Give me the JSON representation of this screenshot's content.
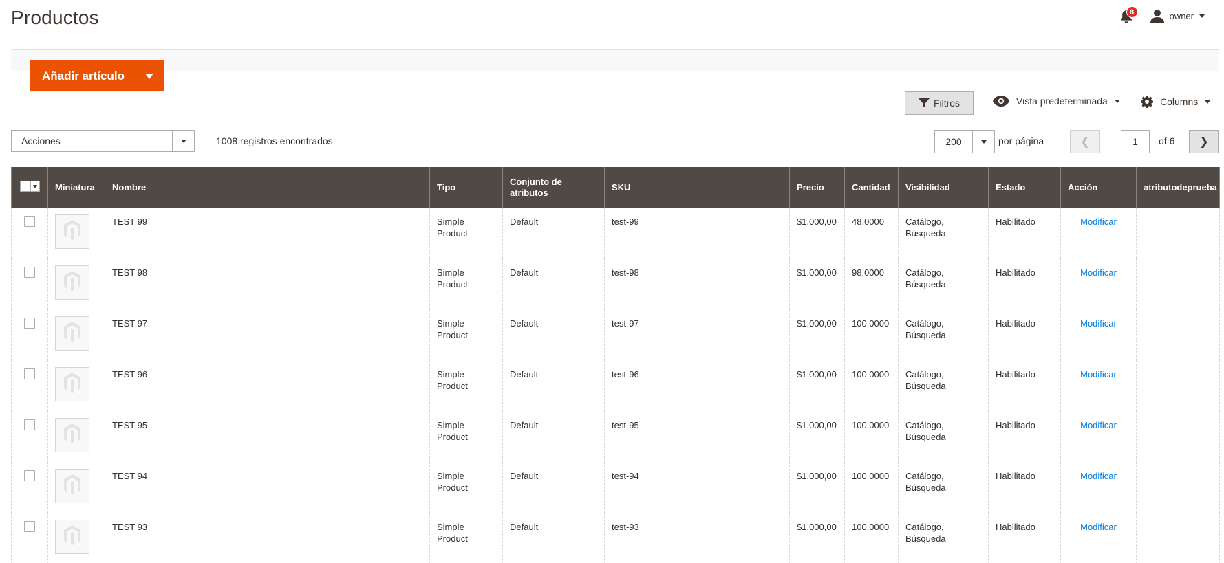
{
  "page": {
    "title": "Productos"
  },
  "header": {
    "notifications_count": "8",
    "user_name": "owner"
  },
  "toolbar": {
    "add_label": "Añadir artículo"
  },
  "controls": {
    "filters_label": "Filtros",
    "view_label": "Vista predeterminada",
    "columns_label": "Columns"
  },
  "mass_actions": {
    "value": "Acciones"
  },
  "records_found": "1008 registros encontrados",
  "pagination": {
    "per_page": "200",
    "per_page_label": "por página",
    "current_page": "1",
    "of_label": "of 6"
  },
  "table": {
    "headers": [
      "Miniatura",
      "Nombre",
      "Tipo",
      "Conjunto de atributos",
      "SKU",
      "Precio",
      "Cantidad",
      "Visibilidad",
      "Estado",
      "Acción",
      "atributodeprueba"
    ],
    "rows": [
      {
        "name": "TEST 99",
        "type": "Simple Product",
        "set": "Default",
        "sku": "test-99",
        "price": "$1.000,00",
        "qty": "48.0000",
        "visibility": "Catálogo, Búsqueda",
        "status": "Habilitado",
        "action": "Modificar",
        "attr": ""
      },
      {
        "name": "TEST 98",
        "type": "Simple Product",
        "set": "Default",
        "sku": "test-98",
        "price": "$1.000,00",
        "qty": "98.0000",
        "visibility": "Catálogo, Búsqueda",
        "status": "Habilitado",
        "action": "Modificar",
        "attr": ""
      },
      {
        "name": "TEST 97",
        "type": "Simple Product",
        "set": "Default",
        "sku": "test-97",
        "price": "$1.000,00",
        "qty": "100.0000",
        "visibility": "Catálogo, Búsqueda",
        "status": "Habilitado",
        "action": "Modificar",
        "attr": ""
      },
      {
        "name": "TEST 96",
        "type": "Simple Product",
        "set": "Default",
        "sku": "test-96",
        "price": "$1.000,00",
        "qty": "100.0000",
        "visibility": "Catálogo, Búsqueda",
        "status": "Habilitado",
        "action": "Modificar",
        "attr": ""
      },
      {
        "name": "TEST 95",
        "type": "Simple Product",
        "set": "Default",
        "sku": "test-95",
        "price": "$1.000,00",
        "qty": "100.0000",
        "visibility": "Catálogo, Búsqueda",
        "status": "Habilitado",
        "action": "Modificar",
        "attr": ""
      },
      {
        "name": "TEST 94",
        "type": "Simple Product",
        "set": "Default",
        "sku": "test-94",
        "price": "$1.000,00",
        "qty": "100.0000",
        "visibility": "Catálogo, Búsqueda",
        "status": "Habilitado",
        "action": "Modificar",
        "attr": ""
      },
      {
        "name": "TEST 93",
        "type": "Simple Product",
        "set": "Default",
        "sku": "test-93",
        "price": "$1.000,00",
        "qty": "100.0000",
        "visibility": "Catálogo, Búsqueda",
        "status": "Habilitado",
        "action": "Modificar",
        "attr": ""
      }
    ]
  },
  "colors": {
    "accent": "#eb5202",
    "header_bg": "#514943",
    "link": "#007bdb",
    "badge": "#e22626"
  },
  "icons": [
    "bell-icon",
    "user-icon",
    "filter-icon",
    "eye-icon",
    "gear-icon",
    "chevron-left-icon",
    "chevron-right-icon",
    "magento-placeholder-icon"
  ]
}
